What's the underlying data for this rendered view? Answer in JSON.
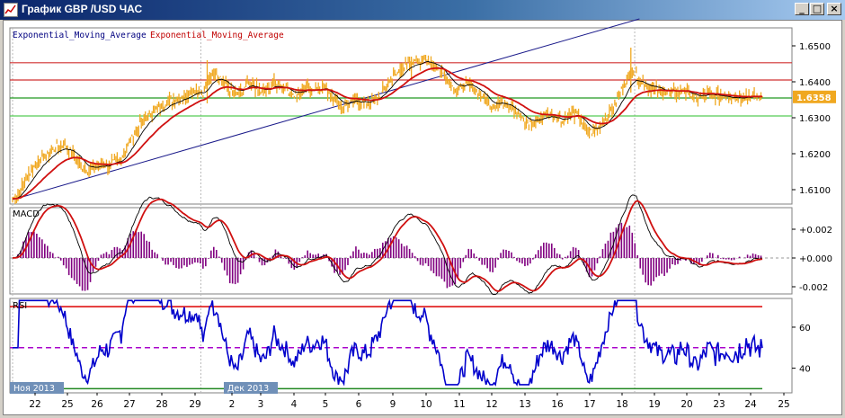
{
  "window": {
    "title": "График GBP /USD ЧАС",
    "buttons": {
      "minimize": "_",
      "restore": "□",
      "close": "×"
    }
  },
  "chart_data": {
    "type": "line",
    "instrument": "GBP/USD",
    "timeframe": "ЧАС",
    "x_ticks": [
      "22",
      "25",
      "26",
      "27",
      "28",
      "29",
      "2",
      "3",
      "4",
      "5",
      "6",
      "9",
      "10",
      "11",
      "12",
      "13",
      "16",
      "17",
      "18",
      "19",
      "20",
      "23",
      "24",
      "25"
    ],
    "date_tags": [
      "Ноя 2013",
      "Дек 2013"
    ],
    "price": {
      "legend": [
        "Exponential_Moving_Average",
        "Exponential_Moving_Average"
      ],
      "ylim": [
        1.606,
        1.655
      ],
      "y_ticks": [
        1.61,
        1.62,
        1.63,
        1.64,
        1.65
      ],
      "y_tick_labels": [
        "1.6100",
        "1.6200",
        "1.6300",
        "1.6400",
        "1.6500"
      ],
      "current_price": 1.6358,
      "current_price_label": "1.6358",
      "hlines": [
        {
          "value": 1.6453,
          "color": "#d03030"
        },
        {
          "value": 1.6405,
          "color": "#d03030"
        },
        {
          "value": 1.6355,
          "color": "#229922"
        },
        {
          "value": 1.6305,
          "color": "#55cc55"
        }
      ],
      "trendlines": [
        {
          "from": [
            0,
            1.6072
          ],
          "to": [
            19.65,
            1.6575
          ]
        }
      ],
      "close": [
        [
          0,
          1.6075
        ],
        [
          0.2,
          1.609
        ],
        [
          0.4,
          1.6125
        ],
        [
          0.6,
          1.6155
        ],
        [
          0.8,
          1.6178
        ],
        [
          1,
          1.6192
        ],
        [
          1.2,
          1.6205
        ],
        [
          1.4,
          1.622
        ],
        [
          1.6,
          1.6222
        ],
        [
          1.8,
          1.6208
        ],
        [
          2,
          1.619
        ],
        [
          2.2,
          1.6162
        ],
        [
          2.4,
          1.6152
        ],
        [
          2.6,
          1.616
        ],
        [
          2.8,
          1.617
        ],
        [
          3,
          1.6168
        ],
        [
          3.2,
          1.6175
        ],
        [
          3.4,
          1.6185
        ],
        [
          3.6,
          1.622
        ],
        [
          3.8,
          1.6255
        ],
        [
          4,
          1.6282
        ],
        [
          4.2,
          1.6302
        ],
        [
          4.4,
          1.6318
        ],
        [
          4.6,
          1.6328
        ],
        [
          4.8,
          1.6342
        ],
        [
          5,
          1.6348
        ],
        [
          5.2,
          1.6355
        ],
        [
          5.4,
          1.6362
        ],
        [
          5.6,
          1.6372
        ],
        [
          5.8,
          1.6382
        ],
        [
          6,
          1.6362
        ],
        [
          6.2,
          1.642
        ],
        [
          6.4,
          1.6425
        ],
        [
          6.6,
          1.6402
        ],
        [
          6.8,
          1.638
        ],
        [
          7,
          1.636
        ],
        [
          7.2,
          1.6372
        ],
        [
          7.4,
          1.6395
        ],
        [
          7.6,
          1.6385
        ],
        [
          7.8,
          1.637
        ],
        [
          8,
          1.6375
        ],
        [
          8.2,
          1.6395
        ],
        [
          8.4,
          1.6388
        ],
        [
          8.6,
          1.6382
        ],
        [
          8.8,
          1.6362
        ],
        [
          9,
          1.6368
        ],
        [
          9.2,
          1.6382
        ],
        [
          9.4,
          1.6378
        ],
        [
          9.6,
          1.6385
        ],
        [
          9.8,
          1.6382
        ],
        [
          10,
          1.6362
        ],
        [
          10.2,
          1.6338
        ],
        [
          10.4,
          1.633
        ],
        [
          10.6,
          1.6342
        ],
        [
          10.8,
          1.635
        ],
        [
          11,
          1.6342
        ],
        [
          11.2,
          1.6345
        ],
        [
          11.4,
          1.6355
        ],
        [
          11.6,
          1.6372
        ],
        [
          11.8,
          1.6402
        ],
        [
          12,
          1.6418
        ],
        [
          12.2,
          1.6438
        ],
        [
          12.4,
          1.6448
        ],
        [
          12.6,
          1.6455
        ],
        [
          12.8,
          1.646
        ],
        [
          13,
          1.6458
        ],
        [
          13.2,
          1.645
        ],
        [
          13.4,
          1.6435
        ],
        [
          13.6,
          1.6405
        ],
        [
          13.8,
          1.6385
        ],
        [
          14,
          1.6378
        ],
        [
          14.2,
          1.6392
        ],
        [
          14.4,
          1.6388
        ],
        [
          14.6,
          1.6372
        ],
        [
          14.8,
          1.6352
        ],
        [
          15,
          1.633
        ],
        [
          15.2,
          1.6338
        ],
        [
          15.4,
          1.6342
        ],
        [
          15.6,
          1.6338
        ],
        [
          15.8,
          1.6312
        ],
        [
          16,
          1.6292
        ],
        [
          16.2,
          1.6282
        ],
        [
          16.4,
          1.6292
        ],
        [
          16.6,
          1.6302
        ],
        [
          16.8,
          1.6308
        ],
        [
          17,
          1.6305
        ],
        [
          17.2,
          1.6292
        ],
        [
          17.4,
          1.6302
        ],
        [
          17.6,
          1.6312
        ],
        [
          17.8,
          1.6298
        ],
        [
          18,
          1.6262
        ],
        [
          18.2,
          1.6258
        ],
        [
          18.4,
          1.6278
        ],
        [
          18.6,
          1.6298
        ],
        [
          18.8,
          1.6325
        ],
        [
          19,
          1.6362
        ],
        [
          19.2,
          1.6395
        ],
        [
          19.4,
          1.6432
        ],
        [
          19.6,
          1.641
        ],
        [
          19.8,
          1.6392
        ],
        [
          20,
          1.6385
        ],
        [
          20.2,
          1.6378
        ],
        [
          20.4,
          1.6375
        ],
        [
          20.6,
          1.6372
        ],
        [
          20.8,
          1.637
        ],
        [
          21,
          1.6378
        ],
        [
          21.2,
          1.6368
        ],
        [
          21.4,
          1.6355
        ],
        [
          21.6,
          1.6358
        ],
        [
          21.8,
          1.6365
        ],
        [
          22,
          1.6362
        ],
        [
          22.2,
          1.636
        ],
        [
          22.4,
          1.6362
        ],
        [
          22.6,
          1.6358
        ],
        [
          22.8,
          1.6358
        ],
        [
          23,
          1.6362
        ],
        [
          23.2,
          1.6358
        ],
        [
          23.5,
          1.6358
        ]
      ]
    },
    "macd": {
      "label": "MACD",
      "ylim": [
        -0.0025,
        0.0035
      ],
      "y_ticks": [
        0.002,
        0,
        -0.002
      ],
      "y_tick_labels": [
        "+0.002",
        "+0.000",
        "-0.002"
      ]
    },
    "rsi": {
      "label": "RSI",
      "ylim": [
        28,
        74
      ],
      "y_ticks": [
        60,
        40
      ],
      "y_tick_labels": [
        "60",
        "40"
      ],
      "levels": [
        {
          "value": 70,
          "color": "#dd0000"
        },
        {
          "value": 50,
          "color": "#aa00cc",
          "dashed": true
        },
        {
          "value": 30,
          "color": "#228822"
        }
      ]
    }
  }
}
